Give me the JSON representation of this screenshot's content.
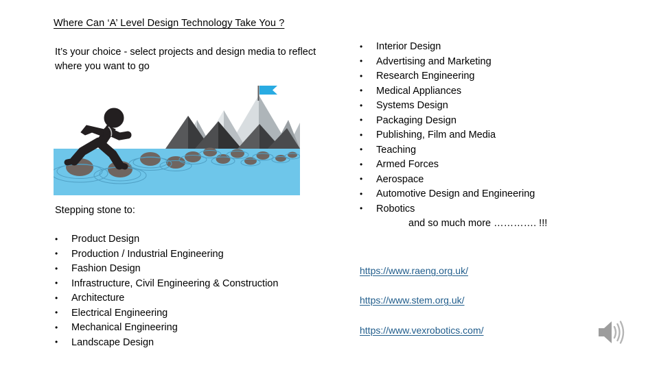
{
  "slide": {
    "title": "Where Can ‘A’ Level Design Technology Take You ?",
    "intro": "It’s your choice - select projects and design media to reflect where you want to go",
    "stepping_heading": "Stepping stone to:",
    "more_text": "and so much more …………. !!!",
    "background_color": "#ffffff",
    "text_color": "#000000",
    "link_color": "#1f5c8b"
  },
  "picture": {
    "alt_name": "stepping-stones-to-mountain-illustration",
    "water_color": "#6ec6ea",
    "figure_color": "#231f20",
    "stone_color": "#6f6560",
    "flag_color": "#29abe2",
    "mountain_light_color": "#d8dde0",
    "mountain_mid_color": "#9aa0a4",
    "mountain_dark_color": "#4d4d4d"
  },
  "left_list": {
    "items": [
      "Product Design",
      "Production / Industrial Engineering",
      "Fashion Design",
      "Infrastructure, Civil Engineering & Construction",
      "Architecture",
      "Electrical Engineering",
      "Mechanical Engineering",
      "Landscape Design"
    ]
  },
  "right_list": {
    "items": [
      "Interior Design",
      "Advertising and Marketing",
      "Research Engineering",
      "Medical Appliances",
      "Systems Design",
      "Packaging Design",
      "Publishing, Film and Media",
      "Teaching",
      "Armed Forces",
      "Aerospace",
      "Automotive Design and Engineering",
      "Robotics"
    ]
  },
  "links": [
    "https://www.raeng.org.uk/",
    "https://www.stem.org.uk/",
    "https://www.vexrobotics.com/"
  ],
  "media": {
    "speaker_icon_name": "speaker-audio-icon",
    "speaker_color": "#9d9d9d"
  }
}
